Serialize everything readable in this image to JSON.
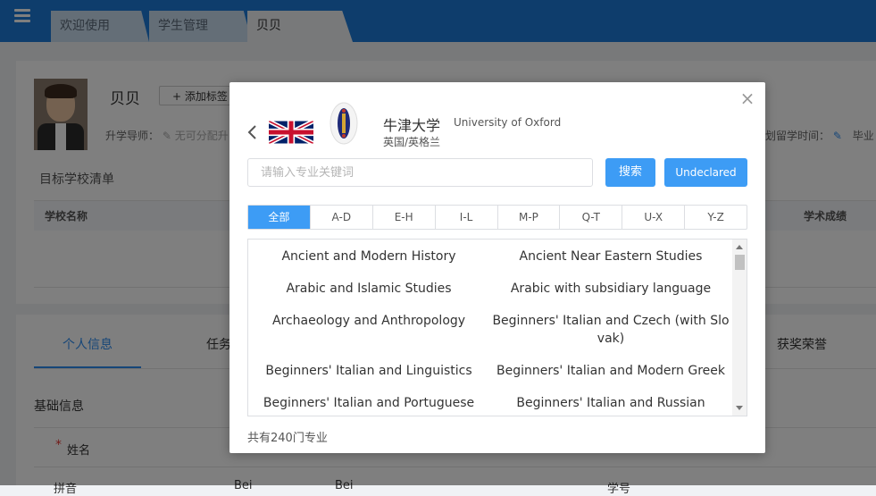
{
  "topbar": {
    "tabs": [
      "欢迎使用",
      "学生管理",
      "贝贝"
    ]
  },
  "profile": {
    "name": "贝贝",
    "add_tag": "+ 添加标签",
    "advisor_label": "升学导师：",
    "advisor_value": "无可分配升",
    "plan_label": "划留学时间：",
    "plan_extra": "毕业"
  },
  "target_schools": {
    "title": "目标学校清单",
    "col_school": "学校名称",
    "col_academic": "学术成绩"
  },
  "detail_tabs": {
    "active": "个人信息",
    "task": "任务",
    "award": "获奖荣誉"
  },
  "basic_info": {
    "title": "基础信息",
    "required_mark": "*",
    "name_label": "姓名",
    "pinyin_label": "拼音",
    "pinyin_first": "Bei",
    "pinyin_last": "Bei",
    "student_no_label": "学号"
  },
  "modal": {
    "close_glyph": "×",
    "university_cn": "牛津大学",
    "university_en": "University of Oxford",
    "location": "英国/英格兰",
    "search_placeholder": "请输入专业关键词",
    "search_button": "搜索",
    "undeclared_button": "Undeclared",
    "letter_tabs": [
      "全部",
      "A-D",
      "E-H",
      "I-L",
      "M-P",
      "Q-T",
      "U-X",
      "Y-Z"
    ],
    "active_tab": "全部",
    "majors": [
      "Ancient and Modern History",
      "Ancient Near Eastern Studies",
      "Arabic and Islamic Studies",
      "Arabic with subsidiary language",
      "Archaeology and Anthropology",
      "Beginners' Italian and Czech (with Slovak)",
      "Beginners' Italian and Linguistics",
      "Beginners' Italian and Modern Greek",
      "Beginners' Italian and Portuguese",
      "Beginners' Italian and Russian"
    ],
    "total_text": "共有240门专业"
  },
  "icons": {
    "menu": "menu-icon",
    "back": "chevron-left-icon",
    "close": "close-icon",
    "flag": "uk-flag-icon",
    "crest": "oxford-crest-icon",
    "edit": "edit-icon"
  },
  "colors": {
    "brand": "#1d7ad9",
    "accent": "#3d9cf5"
  }
}
